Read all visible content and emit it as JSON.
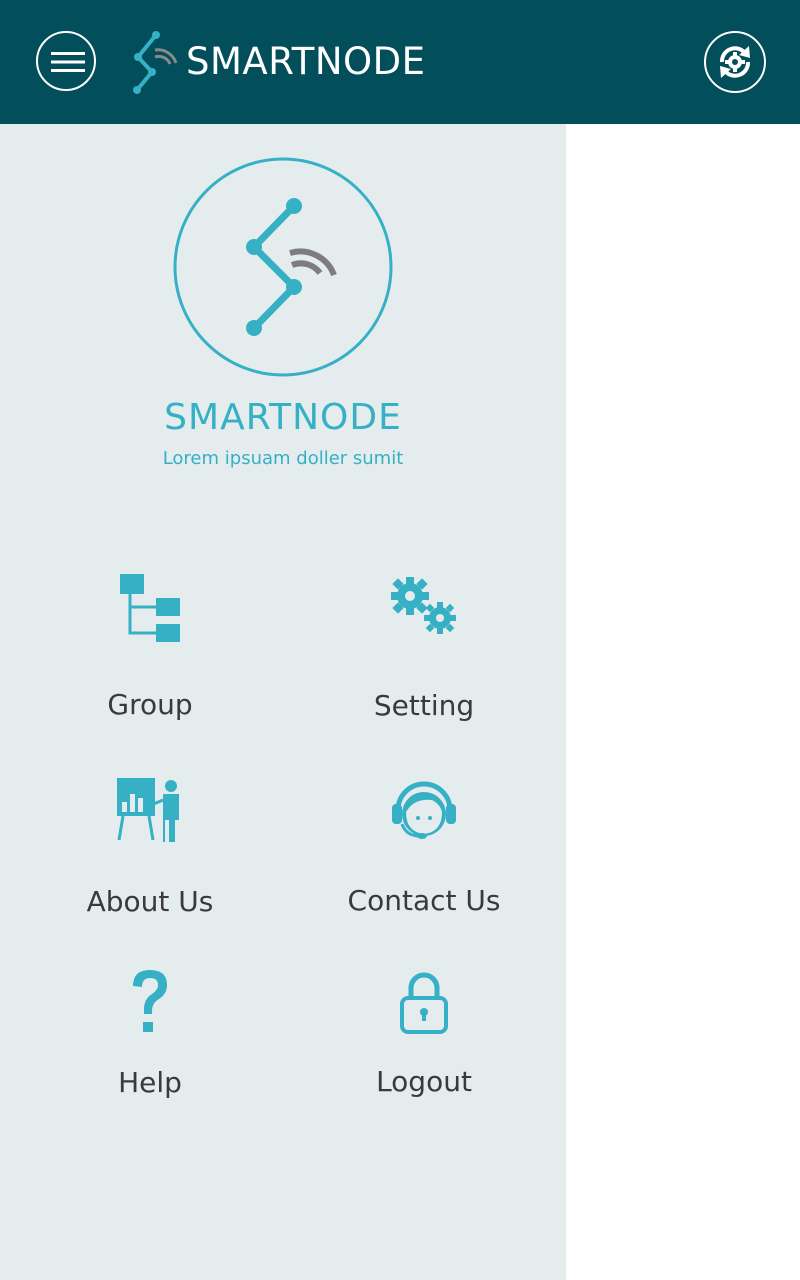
{
  "app": {
    "title": "SMARTNODE",
    "colors": {
      "header": "#024e5b",
      "accent": "#35b0c4",
      "drawer": "#e5ecee",
      "text": "#3a3a3a"
    }
  },
  "header": {
    "menu_icon": "hamburger-icon",
    "sync_icon": "gear-sync-icon"
  },
  "drawer": {
    "title": "SMARTNODE",
    "subtitle": "Lorem ipsuam doller sumit",
    "items": [
      {
        "label": "Group",
        "icon": "group-hierarchy-icon"
      },
      {
        "label": "Setting",
        "icon": "gears-icon"
      },
      {
        "label": "About Us",
        "icon": "presenter-icon"
      },
      {
        "label": "Contact Us",
        "icon": "headset-support-icon"
      },
      {
        "label": "Help",
        "icon": "question-mark-icon"
      },
      {
        "label": "Logout",
        "icon": "padlock-icon"
      }
    ]
  }
}
